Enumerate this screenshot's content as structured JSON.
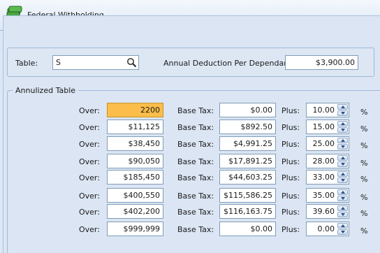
{
  "window": {
    "title": "Federal Withholding"
  },
  "header": {
    "table_label": "Table:",
    "table_value": "S",
    "deduction_label": "Annual Deduction Per Dependant:",
    "deduction_value": "$3,900.00"
  },
  "annualized": {
    "group_title": "Annulized Table",
    "over_label": "Over:",
    "base_label": "Base Tax:",
    "plus_label": "Plus:",
    "pct_label": "%",
    "rows": [
      {
        "over": "2200",
        "base": "$0.00",
        "plus": "10.00"
      },
      {
        "over": "$11,125",
        "base": "$892.50",
        "plus": "15.00"
      },
      {
        "over": "$38,450",
        "base": "$4,991.25",
        "plus": "25.00"
      },
      {
        "over": "$90,050",
        "base": "$17,891.25",
        "plus": "28.00"
      },
      {
        "over": "$185,450",
        "base": "$44,603.25",
        "plus": "33.00"
      },
      {
        "over": "$400,550",
        "base": "$115,586.25",
        "plus": "35.00"
      },
      {
        "over": "$402,200",
        "base": "$116,163.75",
        "plus": "39.60"
      },
      {
        "over": "$999,999",
        "base": "$0.00",
        "plus": "0.00"
      }
    ]
  }
}
